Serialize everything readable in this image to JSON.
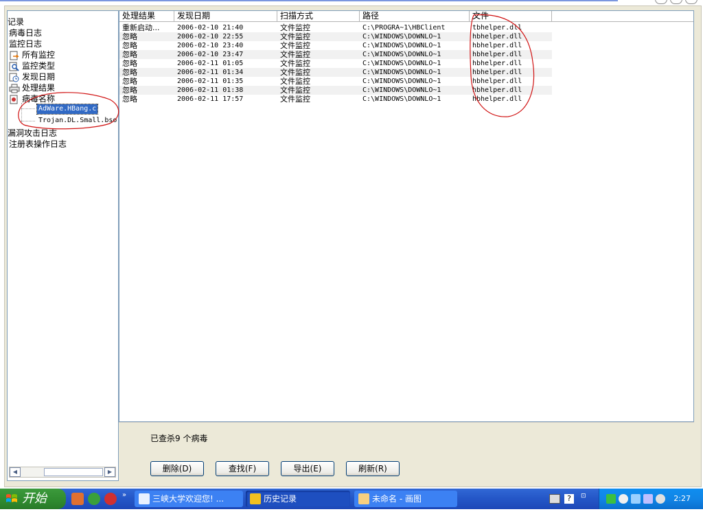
{
  "tree": {
    "items": [
      {
        "label": "记录",
        "level": 0
      },
      {
        "label": "病毒日志",
        "level": 0
      },
      {
        "label": "监控日志",
        "level": 0
      },
      {
        "label": "所有监控",
        "level": 1
      },
      {
        "label": "监控类型",
        "level": 1
      },
      {
        "label": "发现日期",
        "level": 1
      },
      {
        "label": "处理结果",
        "level": 1
      },
      {
        "label": "病毒名称",
        "level": 1
      },
      {
        "label": "漏洞攻击日志",
        "level": 0
      },
      {
        "label": "注册表操作日志",
        "level": 0
      }
    ],
    "leaves": [
      {
        "label": "AdWare.HBang.c",
        "selected": true
      },
      {
        "label": "Trojan.DL.Small.bso",
        "selected": false
      }
    ]
  },
  "list": {
    "columns": [
      "处理结果",
      "发现日期",
      "扫描方式",
      "路径",
      "文件"
    ],
    "rows": [
      [
        "重新启动...",
        "2006-02-10 21:40",
        "文件监控",
        "C:\\PROGRA~1\\HBClient",
        "tbhelper.dll"
      ],
      [
        "忽略",
        "2006-02-10 22:55",
        "文件监控",
        "C:\\WINDOWS\\DOWNLO~1",
        "hbhelper.dll"
      ],
      [
        "忽略",
        "2006-02-10 23:40",
        "文件监控",
        "C:\\WINDOWS\\DOWNLO~1",
        "hbhelper.dll"
      ],
      [
        "忽略",
        "2006-02-10 23:47",
        "文件监控",
        "C:\\WINDOWS\\DOWNLO~1",
        "hbhelper.dll"
      ],
      [
        "忽略",
        "2006-02-11 01:05",
        "文件监控",
        "C:\\WINDOWS\\DOWNLO~1",
        "hbhelper.dll"
      ],
      [
        "忽略",
        "2006-02-11 01:34",
        "文件监控",
        "C:\\WINDOWS\\DOWNLO~1",
        "hbhelper.dll"
      ],
      [
        "忽略",
        "2006-02-11 01:35",
        "文件监控",
        "C:\\WINDOWS\\DOWNLO~1",
        "hbhelper.dll"
      ],
      [
        "忽略",
        "2006-02-11 01:38",
        "文件监控",
        "C:\\WINDOWS\\DOWNLO~1",
        "hbhelper.dll"
      ],
      [
        "忽略",
        "2006-02-11 17:57",
        "文件监控",
        "C:\\WINDOWS\\DOWNLO~1",
        "hbhelper.dll"
      ]
    ]
  },
  "bottom": {
    "status": "已查杀9 个病毒",
    "buttons": [
      "删除(D)",
      "查找(F)",
      "导出(E)",
      "刷新(R)"
    ]
  },
  "taskbar": {
    "start": "开始",
    "tasks": [
      "三峡大学欢迎您! ...",
      "历史记录",
      "未命名 - 画图"
    ],
    "clock": "2:27"
  },
  "colors": {
    "annotation": "#d01010",
    "selection": "#316ac5",
    "taskbar": "#245edb"
  }
}
